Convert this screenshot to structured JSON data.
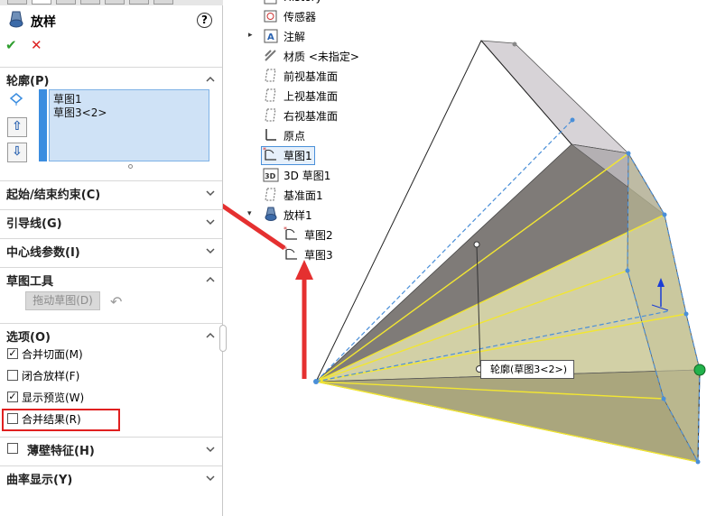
{
  "property_manager": {
    "title": "放样",
    "help": "?",
    "ok": "✔",
    "cancel": "✕"
  },
  "sections": {
    "profiles": "轮廓(P)",
    "start_end": "起始/结束约束(C)",
    "guide_curves": "引导线(G)",
    "centerline": "中心线参数(I)",
    "sketch_tools": "草图工具",
    "options": "选项(O)",
    "thin_feature": "薄壁特征(H)",
    "curvature_display": "曲率显示(Y)"
  },
  "profiles": {
    "items": [
      "草图1",
      "草图3<2>"
    ],
    "move_up": "⇧",
    "move_down": "⇩"
  },
  "sketch_tools": {
    "drag_sketch": "拖动草图(D)",
    "undo": "↶"
  },
  "options": [
    {
      "label": "合并切面(M)",
      "checked": true
    },
    {
      "label": "闭合放样(F)",
      "checked": false
    },
    {
      "label": "显示预览(W)",
      "checked": true
    },
    {
      "label": "合并结果(R)",
      "checked": false
    }
  ],
  "thin_feature": {
    "checked": false
  },
  "tree": {
    "items": [
      {
        "label": "History",
        "icon": "history-icon"
      },
      {
        "label": "传感器",
        "icon": "sensor-icon"
      },
      {
        "label": "注解",
        "icon": "annotation-icon"
      },
      {
        "label": "材质 <未指定>",
        "icon": "material-icon"
      },
      {
        "label": "前视基准面",
        "icon": "plane-icon"
      },
      {
        "label": "上视基准面",
        "icon": "plane-icon"
      },
      {
        "label": "右视基准面",
        "icon": "plane-icon"
      },
      {
        "label": "原点",
        "icon": "origin-icon"
      },
      {
        "label": "草图1",
        "icon": "sketch-icon"
      },
      {
        "label": "3D 草图1",
        "icon": "3d-sketch-icon"
      },
      {
        "label": "基准面1",
        "icon": "plane-icon"
      },
      {
        "label": "放样1",
        "icon": "loft-icon"
      },
      {
        "label": "草图2",
        "icon": "sketch-icon"
      },
      {
        "label": "草图3",
        "icon": "sketch-icon"
      }
    ]
  },
  "viewport": {
    "callout": "轮廓(草图3<2>)"
  },
  "colors": {
    "accent": "#3b8de0",
    "highlight": "#e02020",
    "ok": "#2f9e2f",
    "cancel": "#d22222",
    "shape_dark": "#7f7b78",
    "shape_light": "#d7d3d7",
    "shape_yellow": "#c9c79a",
    "preview_line": "#f2e632"
  }
}
